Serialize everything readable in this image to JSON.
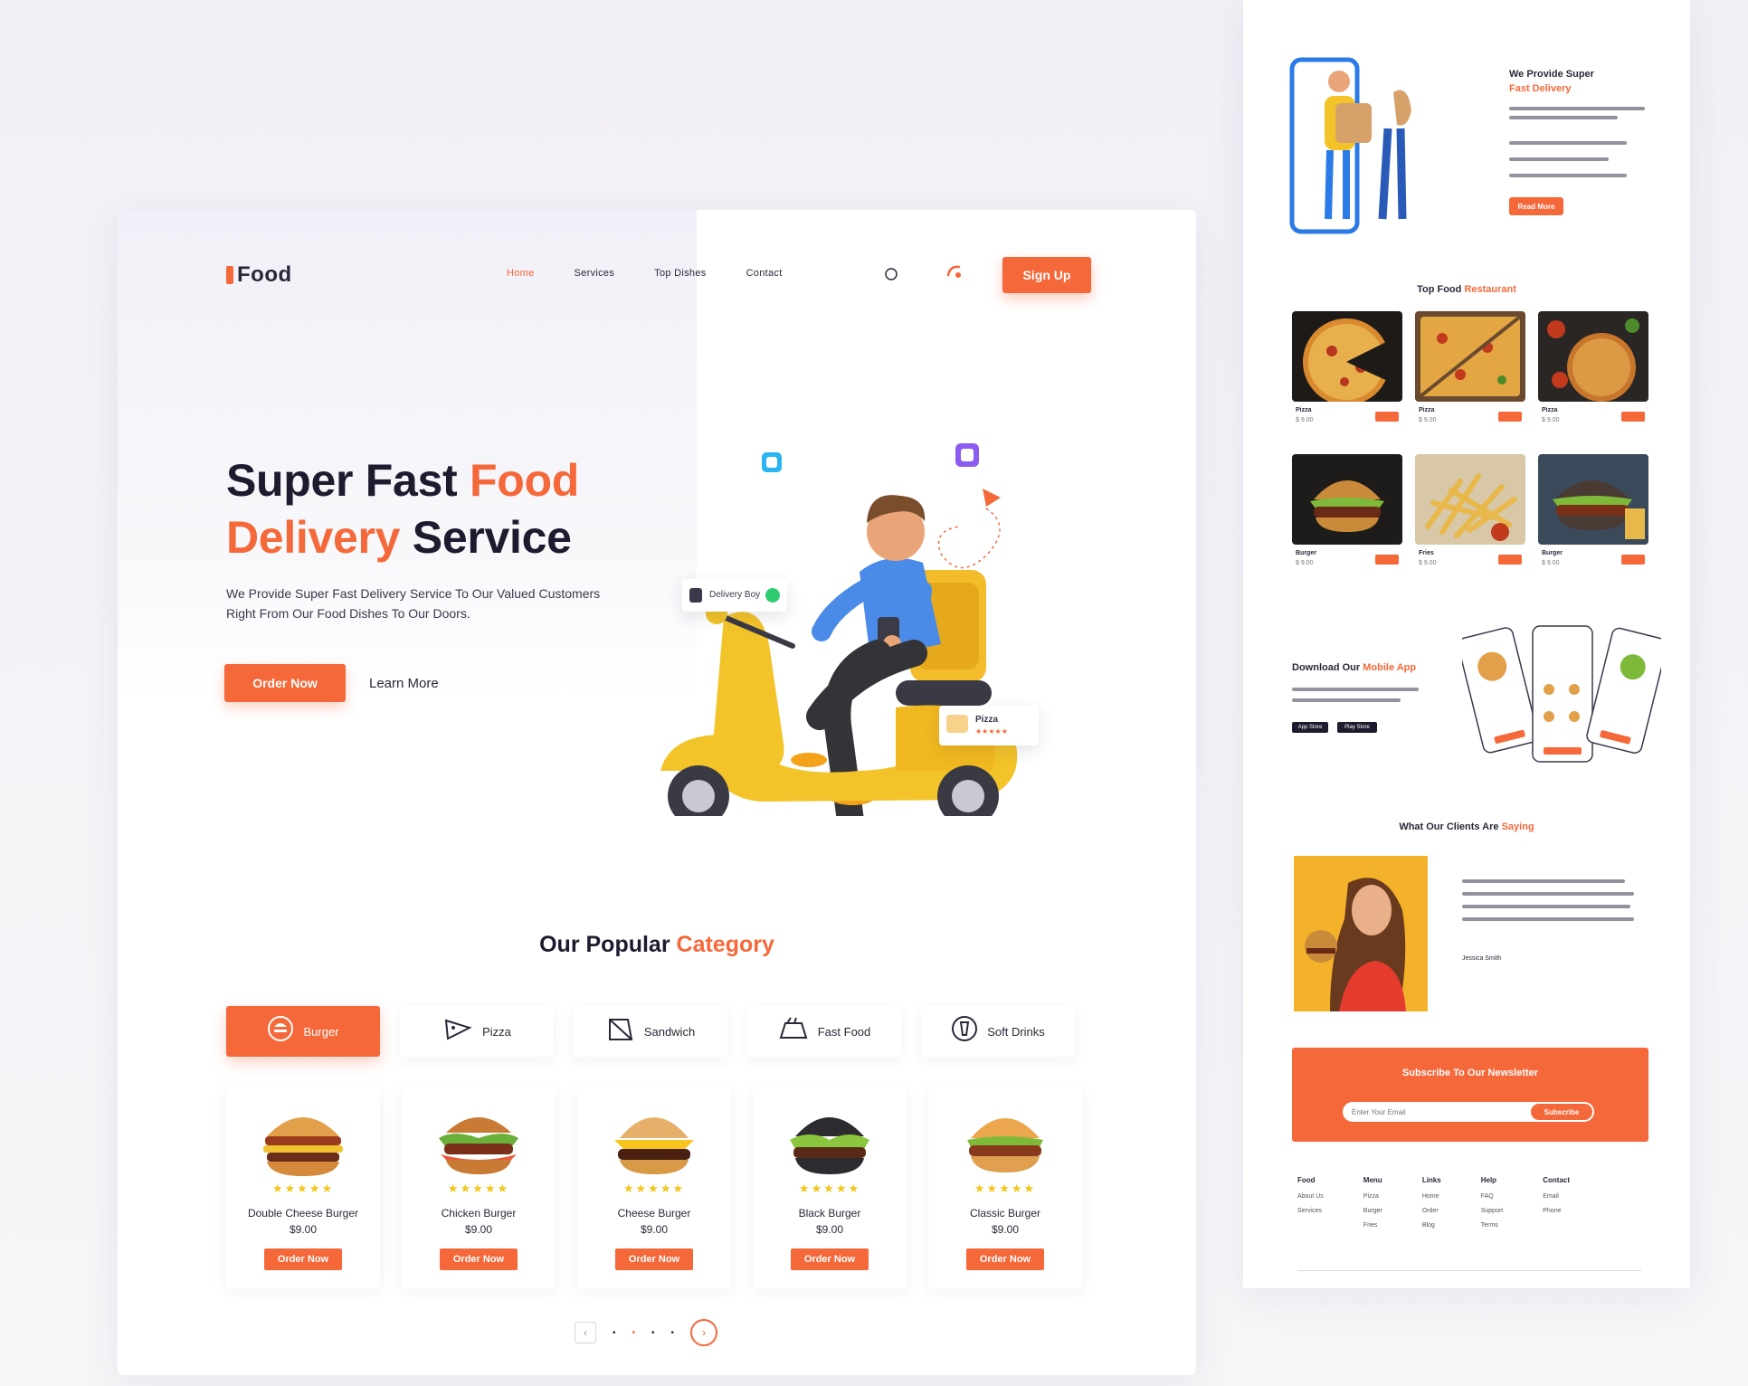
{
  "nav": {
    "logo": "Food",
    "links": [
      "Home",
      "Services",
      "Top Dishes",
      "Contact"
    ],
    "cta_label": "Sign Up"
  },
  "hero": {
    "title_part1": "Super Fast ",
    "title_accent1": "Food",
    "title_accent2": "Delivery",
    "title_part2": " Service",
    "subtitle": "We Provide Super Fast Delivery Service To Our Valued Customers Right From Our Food Dishes To Our Doors.",
    "primary_button": "Order Now",
    "secondary_link": "Learn More",
    "float_card_1": "Delivery Boy",
    "float_card_2": "Pizza"
  },
  "category": {
    "title_part1": "Our Popular ",
    "title_accent": "Category",
    "tabs": [
      {
        "label": "Burger",
        "icon": "burger-icon"
      },
      {
        "label": "Pizza",
        "icon": "pizza-icon"
      },
      {
        "label": "Sandwich",
        "icon": "sandwich-icon"
      },
      {
        "label": "Fast Food",
        "icon": "fast-food-icon"
      },
      {
        "label": "Soft Drinks",
        "icon": "drink-icon"
      }
    ],
    "products": [
      {
        "name": "Double Cheese Burger",
        "price": "$9.00",
        "button": "Order Now"
      },
      {
        "name": "Chicken Burger",
        "price": "$9.00",
        "button": "Order Now"
      },
      {
        "name": "Cheese Burger",
        "price": "$9.00",
        "button": "Order Now"
      },
      {
        "name": "Black Burger",
        "price": "$9.00",
        "button": "Order Now"
      },
      {
        "name": "Classic Burger",
        "price": "$9.00",
        "button": "Order Now"
      }
    ],
    "rating_stars": "★★★★★",
    "pager": {
      "prev": "‹",
      "dots": [
        "•",
        "•",
        "•",
        "•"
      ],
      "next": "›"
    }
  },
  "side": {
    "about_title": "We Provide Super",
    "about_title_accent": "Fast Delivery",
    "about_button": "Read More",
    "top_food_title": "Top Food",
    "top_food_accent": "Restaurant",
    "dishes": [
      {
        "name": "Pizza",
        "price": "$ 9.00"
      },
      {
        "name": "Pizza",
        "price": "$ 9.00"
      },
      {
        "name": "Pizza",
        "price": "$ 9.00"
      },
      {
        "name": "Burger",
        "price": "$ 9.00"
      },
      {
        "name": "Fries",
        "price": "$ 9.00"
      },
      {
        "name": "Burger",
        "price": "$ 9.00"
      }
    ],
    "app_title": "Download Our",
    "app_title_accent": "Mobile App",
    "app_store_1": "App Store",
    "app_store_2": "Play Store",
    "testimonial_title": "What Our Clients Are",
    "testimonial_accent": "Saying",
    "testimonial_name": "Jessica Smith",
    "newsletter_title": "Subscribe To Our Newsletter",
    "newsletter_placeholder": "Enter Your Email",
    "newsletter_button": "Subscribe",
    "footer": [
      {
        "head": "Food",
        "items": [
          "About Us",
          "Services"
        ]
      },
      {
        "head": "Menu",
        "items": [
          "Pizza",
          "Burger",
          "Fries"
        ]
      },
      {
        "head": "Links",
        "items": [
          "Home",
          "Order",
          "Blog"
        ]
      },
      {
        "head": "Help",
        "items": [
          "FAQ",
          "Support",
          "Terms"
        ]
      },
      {
        "head": "Contact",
        "items": [
          "Email",
          "Phone"
        ]
      }
    ]
  },
  "colors": {
    "accent": "#f5683a",
    "text": "#1d1b2e",
    "star": "#f5c518",
    "bg": "#f2f1f6"
  }
}
